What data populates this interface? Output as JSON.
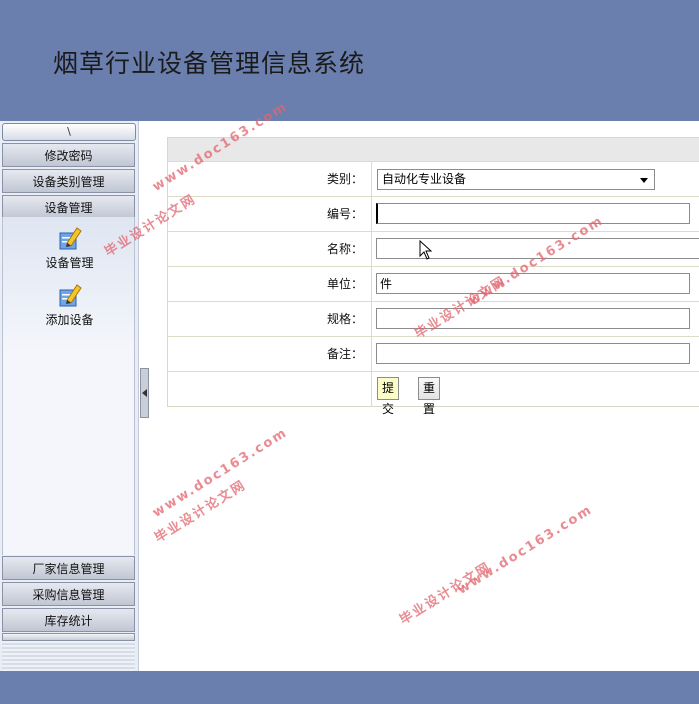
{
  "header": {
    "title": "烟草行业设备管理信息系统"
  },
  "sidebar": {
    "collapse_glyph": "\\",
    "menu_top": [
      {
        "label": "修改密码"
      },
      {
        "label": "设备类别管理"
      },
      {
        "label": "设备管理"
      }
    ],
    "sub_items": [
      {
        "label": "设备管理",
        "icon": "pencil-document-icon"
      },
      {
        "label": "添加设备",
        "icon": "pencil-document-icon"
      }
    ],
    "menu_bottom": [
      {
        "label": "厂家信息管理"
      },
      {
        "label": "采购信息管理"
      },
      {
        "label": "库存统计"
      }
    ]
  },
  "form": {
    "fields": [
      {
        "label": "类别：",
        "type": "select",
        "value": "自动化专业设备"
      },
      {
        "label": "编号：",
        "type": "text",
        "value": ""
      },
      {
        "label": "名称：",
        "type": "text",
        "value": ""
      },
      {
        "label": "单位：",
        "type": "text",
        "value": "件"
      },
      {
        "label": "规格：",
        "type": "text",
        "value": ""
      },
      {
        "label": "备注：",
        "type": "text",
        "value": ""
      }
    ],
    "submit_label": "提交",
    "reset_label": "重置"
  },
  "watermarks": [
    {
      "text": "www.doc163.com"
    },
    {
      "text": "毕业设计论文网"
    }
  ],
  "colors": {
    "header_bg": "#6b7fae",
    "watermark": "#e1646e",
    "submit_bg": "#fdfdc8"
  }
}
